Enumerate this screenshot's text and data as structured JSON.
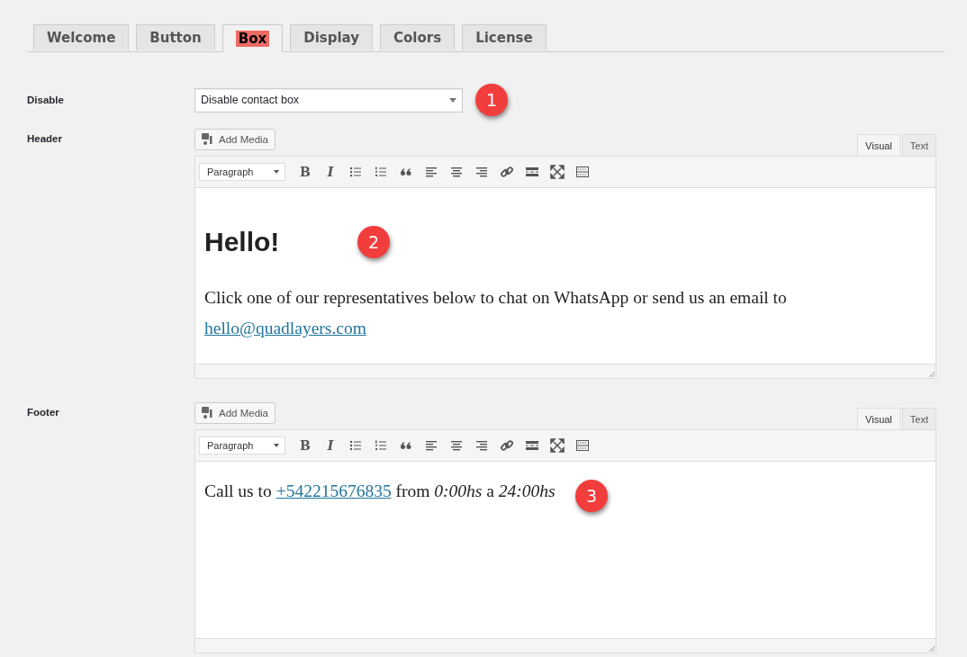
{
  "tabs": [
    {
      "label": "Welcome",
      "selected": false,
      "highlighted": false
    },
    {
      "label": "Button",
      "selected": false,
      "highlighted": false
    },
    {
      "label": "Box",
      "selected": true,
      "highlighted": true
    },
    {
      "label": "Display",
      "selected": false,
      "highlighted": false
    },
    {
      "label": "Colors",
      "selected": false,
      "highlighted": false
    },
    {
      "label": "License",
      "selected": false,
      "highlighted": false
    }
  ],
  "fields": [
    {
      "kind": "select",
      "label": "Disable",
      "value": "Disable contact box",
      "badge": "1"
    },
    {
      "kind": "editor",
      "label": "Header",
      "add_media": "Add Media",
      "modes": [
        {
          "label": "Visual",
          "selected": true
        },
        {
          "label": "Text",
          "selected": false
        }
      ],
      "format": "Paragraph",
      "toolbar": [
        {
          "kind": "bold",
          "glyph": "B"
        },
        {
          "kind": "italic",
          "glyph": "I"
        },
        {
          "kind": "bullets"
        },
        {
          "kind": "numbers"
        },
        {
          "kind": "quote"
        },
        {
          "kind": "align-left"
        },
        {
          "kind": "align-center"
        },
        {
          "kind": "align-right"
        },
        {
          "kind": "link"
        },
        {
          "kind": "more"
        },
        {
          "kind": "fullscreen"
        },
        {
          "kind": "kitchen"
        }
      ],
      "badge": "2",
      "content": [
        {
          "kind": "heading",
          "parts": [
            {
              "kind": "text",
              "text": "Hello!"
            }
          ]
        },
        {
          "kind": "paragraph",
          "parts": [
            {
              "kind": "text",
              "text": "Click one of our representatives below to chat on WhatsApp or send us an email to"
            },
            {
              "kind": "link",
              "text": "hello@quadlayers.com"
            }
          ]
        }
      ]
    },
    {
      "kind": "editor",
      "label": "Footer",
      "add_media": "Add Media",
      "modes": [
        {
          "label": "Visual",
          "selected": true
        },
        {
          "label": "Text",
          "selected": false
        }
      ],
      "format": "Paragraph",
      "toolbar": [
        {
          "kind": "bold",
          "glyph": "B"
        },
        {
          "kind": "italic",
          "glyph": "I"
        },
        {
          "kind": "bullets"
        },
        {
          "kind": "numbers"
        },
        {
          "kind": "quote"
        },
        {
          "kind": "align-left"
        },
        {
          "kind": "align-center"
        },
        {
          "kind": "align-right"
        },
        {
          "kind": "link"
        },
        {
          "kind": "more"
        },
        {
          "kind": "fullscreen"
        },
        {
          "kind": "kitchen"
        }
      ],
      "badge": "3",
      "content": [
        {
          "kind": "paragraph",
          "parts": [
            {
              "kind": "text",
              "text": "Call us to"
            },
            {
              "kind": "link",
              "text": "+542215676835"
            },
            {
              "kind": "text",
              "text": "from *0:00hs* a *24:00hs*"
            }
          ]
        }
      ]
    }
  ]
}
